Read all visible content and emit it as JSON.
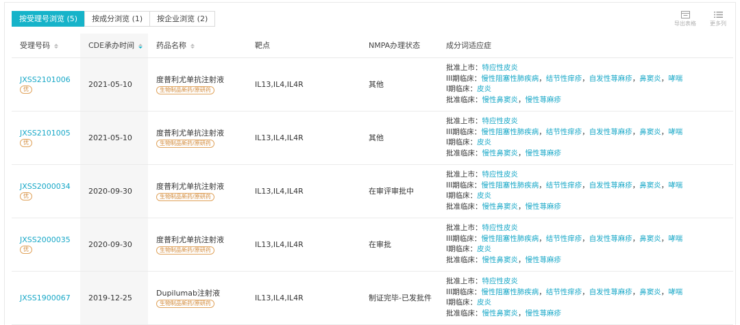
{
  "tabs": [
    {
      "label": "按受理号浏览 (5)",
      "active": true
    },
    {
      "label": "按成分浏览 (1)",
      "active": false
    },
    {
      "label": "按企业浏览 (2)",
      "active": false
    }
  ],
  "toolbar": {
    "export_label": "导出表格",
    "more_label": "更多列"
  },
  "columns": {
    "accept_no": "受理号码",
    "cde_time": "CDE承办时间",
    "drug_name": "药品名称",
    "target": "靶点",
    "nmpa_status": "NMPA办理状态",
    "indications": "成分词适应症"
  },
  "rows": [
    {
      "accept_no": "JXSS2101006",
      "badge": "优",
      "date": "2021-05-10",
      "drug": "度普利尤单抗注射液",
      "tag": "生物制品新药/原研药",
      "target": "IL13,IL4,IL4R",
      "status": "其他",
      "ind": [
        {
          "phase": "批准上市：",
          "items": [
            "特应性皮炎"
          ]
        },
        {
          "phase": "III期临床：",
          "items": [
            "慢性阻塞性肺疾病",
            "结节性痒疹",
            "自发性荨麻疹",
            "鼻窦炎",
            "哮喘"
          ]
        },
        {
          "phase": "I期临床：",
          "items": [
            "皮炎"
          ]
        },
        {
          "phase": "批准临床：",
          "items": [
            "慢性鼻窦炎",
            "慢性荨麻疹"
          ]
        }
      ]
    },
    {
      "accept_no": "JXSS2101005",
      "badge": "优",
      "date": "2021-05-10",
      "drug": "度普利尤单抗注射液",
      "tag": "生物制品新药/原研药",
      "target": "IL13,IL4,IL4R",
      "status": "其他",
      "ind": [
        {
          "phase": "批准上市：",
          "items": [
            "特应性皮炎"
          ]
        },
        {
          "phase": "III期临床：",
          "items": [
            "慢性阻塞性肺疾病",
            "结节性痒疹",
            "自发性荨麻疹",
            "鼻窦炎",
            "哮喘"
          ]
        },
        {
          "phase": "I期临床：",
          "items": [
            "皮炎"
          ]
        },
        {
          "phase": "批准临床：",
          "items": [
            "慢性鼻窦炎",
            "慢性荨麻疹"
          ]
        }
      ]
    },
    {
      "accept_no": "JXSS2000034",
      "badge": "优",
      "date": "2020-09-30",
      "drug": "度普利尤单抗注射液",
      "tag": "生物制品新药/原研药",
      "target": "IL13,IL4,IL4R",
      "status": "在审评审批中",
      "ind": [
        {
          "phase": "批准上市：",
          "items": [
            "特应性皮炎"
          ]
        },
        {
          "phase": "III期临床：",
          "items": [
            "慢性阻塞性肺疾病",
            "结节性痒疹",
            "自发性荨麻疹",
            "鼻窦炎",
            "哮喘"
          ]
        },
        {
          "phase": "I期临床：",
          "items": [
            "皮炎"
          ]
        },
        {
          "phase": "批准临床：",
          "items": [
            "慢性鼻窦炎",
            "慢性荨麻疹"
          ]
        }
      ]
    },
    {
      "accept_no": "JXSS2000035",
      "badge": "优",
      "date": "2020-09-30",
      "drug": "度普利尤单抗注射液",
      "tag": "生物制品新药/原研药",
      "target": "IL13,IL4,IL4R",
      "status": "在审批",
      "ind": [
        {
          "phase": "批准上市：",
          "items": [
            "特应性皮炎"
          ]
        },
        {
          "phase": "III期临床：",
          "items": [
            "慢性阻塞性肺疾病",
            "结节性痒疹",
            "自发性荨麻疹",
            "鼻窦炎",
            "哮喘"
          ]
        },
        {
          "phase": "I期临床：",
          "items": [
            "皮炎"
          ]
        },
        {
          "phase": "批准临床：",
          "items": [
            "慢性鼻窦炎",
            "慢性荨麻疹"
          ]
        }
      ]
    },
    {
      "accept_no": "JXSS1900067",
      "badge": "",
      "date": "2019-12-25",
      "drug": "Dupilumab注射液",
      "tag": "生物制品新药/原研药",
      "target": "IL13,IL4,IL4R",
      "status": "制证完毕-已发批件",
      "ind": [
        {
          "phase": "批准上市：",
          "items": [
            "特应性皮炎"
          ]
        },
        {
          "phase": "III期临床：",
          "items": [
            "慢性阻塞性肺疾病",
            "结节性痒疹",
            "自发性荨麻疹",
            "鼻窦炎",
            "哮喘"
          ]
        },
        {
          "phase": "I期临床：",
          "items": [
            "皮炎"
          ]
        },
        {
          "phase": "批准临床：",
          "items": [
            "慢性鼻窦炎",
            "慢性荨麻疹"
          ]
        }
      ]
    }
  ],
  "colors": {
    "accent": "#16b3c9",
    "link": "#16a7c7",
    "badge": "#d28a3a"
  }
}
